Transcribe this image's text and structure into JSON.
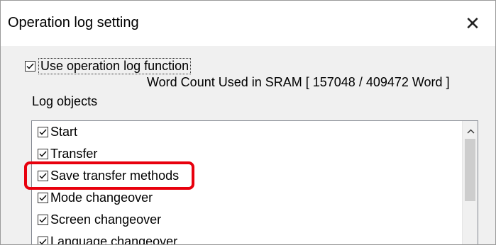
{
  "dialog": {
    "title": "Operation log setting",
    "close_symbol": "✕"
  },
  "options": {
    "use_log_label": "Use operation log function",
    "use_log_checked": true,
    "word_count": "Word Count Used in SRAM  [ 157048 / 409472 Word ]",
    "log_objects_label": "Log objects"
  },
  "log_list": {
    "items": [
      {
        "label": "Start",
        "checked": true
      },
      {
        "label": "Transfer",
        "checked": true
      },
      {
        "label": "Save transfer methods",
        "checked": true
      },
      {
        "label": "Mode changeover",
        "checked": true
      },
      {
        "label": "Screen changeover",
        "checked": true
      },
      {
        "label": "Language changeover",
        "checked": true
      }
    ]
  },
  "icons": {
    "checkbox": "checkmark-icon",
    "scroll_up": "chevron-up-icon"
  },
  "colors": {
    "highlight": "#e8000d"
  }
}
